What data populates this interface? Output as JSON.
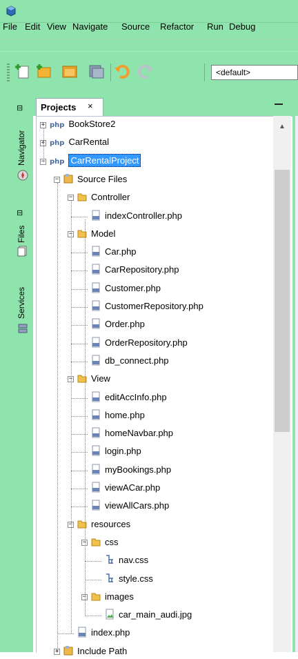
{
  "menu": [
    "File",
    "Edit",
    "View",
    "Navigate",
    "Source",
    "Refactor",
    "Run",
    "Debug"
  ],
  "toolbar": {
    "config_value": "<default>"
  },
  "side_tabs": [
    "Navigator",
    "Files",
    "Services"
  ],
  "panel": {
    "title": "Projects",
    "close": "×"
  },
  "tree": [
    {
      "label": "BookStore2",
      "type": "project",
      "indent": 0,
      "expander": "+"
    },
    {
      "label": "CarRental",
      "type": "project",
      "indent": 0,
      "expander": "+"
    },
    {
      "label": "CarRentalProject",
      "type": "project",
      "indent": 0,
      "expander": "−",
      "selected": true
    },
    {
      "label": "Source Files",
      "type": "package",
      "indent": 1,
      "expander": "−"
    },
    {
      "label": "Controller",
      "type": "folder",
      "indent": 2,
      "expander": "−"
    },
    {
      "label": "indexController.php",
      "type": "php",
      "indent": 3
    },
    {
      "label": "Model",
      "type": "folder",
      "indent": 2,
      "expander": "−"
    },
    {
      "label": "Car.php",
      "type": "php",
      "indent": 3
    },
    {
      "label": "CarRepository.php",
      "type": "php",
      "indent": 3
    },
    {
      "label": "Customer.php",
      "type": "php",
      "indent": 3
    },
    {
      "label": "CustomerRepository.php",
      "type": "php",
      "indent": 3
    },
    {
      "label": "Order.php",
      "type": "php",
      "indent": 3
    },
    {
      "label": "OrderRepository.php",
      "type": "php",
      "indent": 3
    },
    {
      "label": "db_connect.php",
      "type": "php",
      "indent": 3
    },
    {
      "label": "View",
      "type": "folder",
      "indent": 2,
      "expander": "−"
    },
    {
      "label": "editAccInfo.php",
      "type": "php",
      "indent": 3
    },
    {
      "label": "home.php",
      "type": "php",
      "indent": 3
    },
    {
      "label": "homeNavbar.php",
      "type": "php",
      "indent": 3
    },
    {
      "label": "login.php",
      "type": "php",
      "indent": 3
    },
    {
      "label": "myBookings.php",
      "type": "php",
      "indent": 3
    },
    {
      "label": "viewACar.php",
      "type": "php",
      "indent": 3
    },
    {
      "label": "viewAllCars.php",
      "type": "php",
      "indent": 3
    },
    {
      "label": "resources",
      "type": "folder",
      "indent": 2,
      "expander": "−"
    },
    {
      "label": "css",
      "type": "folder",
      "indent": 3,
      "expander": "−"
    },
    {
      "label": "nav.css",
      "type": "css",
      "indent": 4
    },
    {
      "label": "style.css",
      "type": "css",
      "indent": 4
    },
    {
      "label": "images",
      "type": "folder",
      "indent": 3,
      "expander": "−"
    },
    {
      "label": "car_main_audi.jpg",
      "type": "image",
      "indent": 4
    },
    {
      "label": "index.php",
      "type": "php",
      "indent": 2
    },
    {
      "label": "Include Path",
      "type": "package",
      "indent": 1,
      "expander": "+"
    }
  ]
}
